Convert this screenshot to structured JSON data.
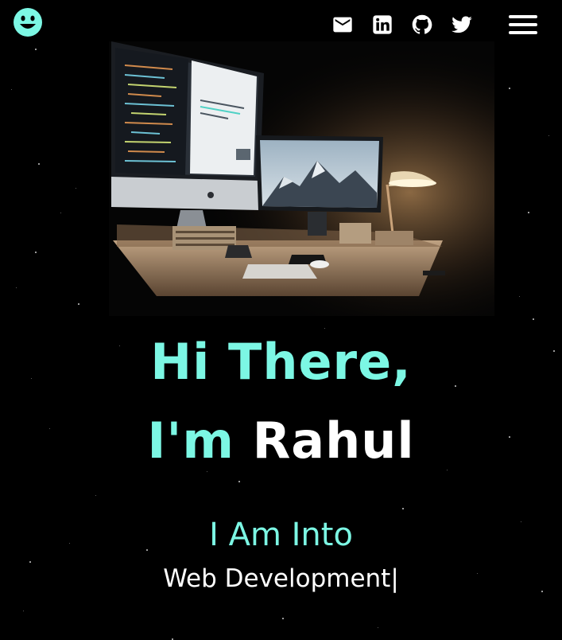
{
  "colors": {
    "accent": "#7cf7e4",
    "background": "#000000",
    "text": "#ffffff"
  },
  "header": {
    "logo_icon": "smiley-face-icon",
    "social_links": [
      {
        "icon": "mail-icon"
      },
      {
        "icon": "linkedin-icon"
      },
      {
        "icon": "github-icon"
      },
      {
        "icon": "twitter-icon"
      }
    ],
    "menu_icon": "hamburger-menu-icon"
  },
  "hero": {
    "image_icon": "desk-setup-illustration",
    "greeting_line1": "Hi There,",
    "greeting_line2_prefix": "I'm ",
    "greeting_name": "Rahul",
    "into_label": "I Am Into",
    "typed_text": "Web Development|"
  }
}
